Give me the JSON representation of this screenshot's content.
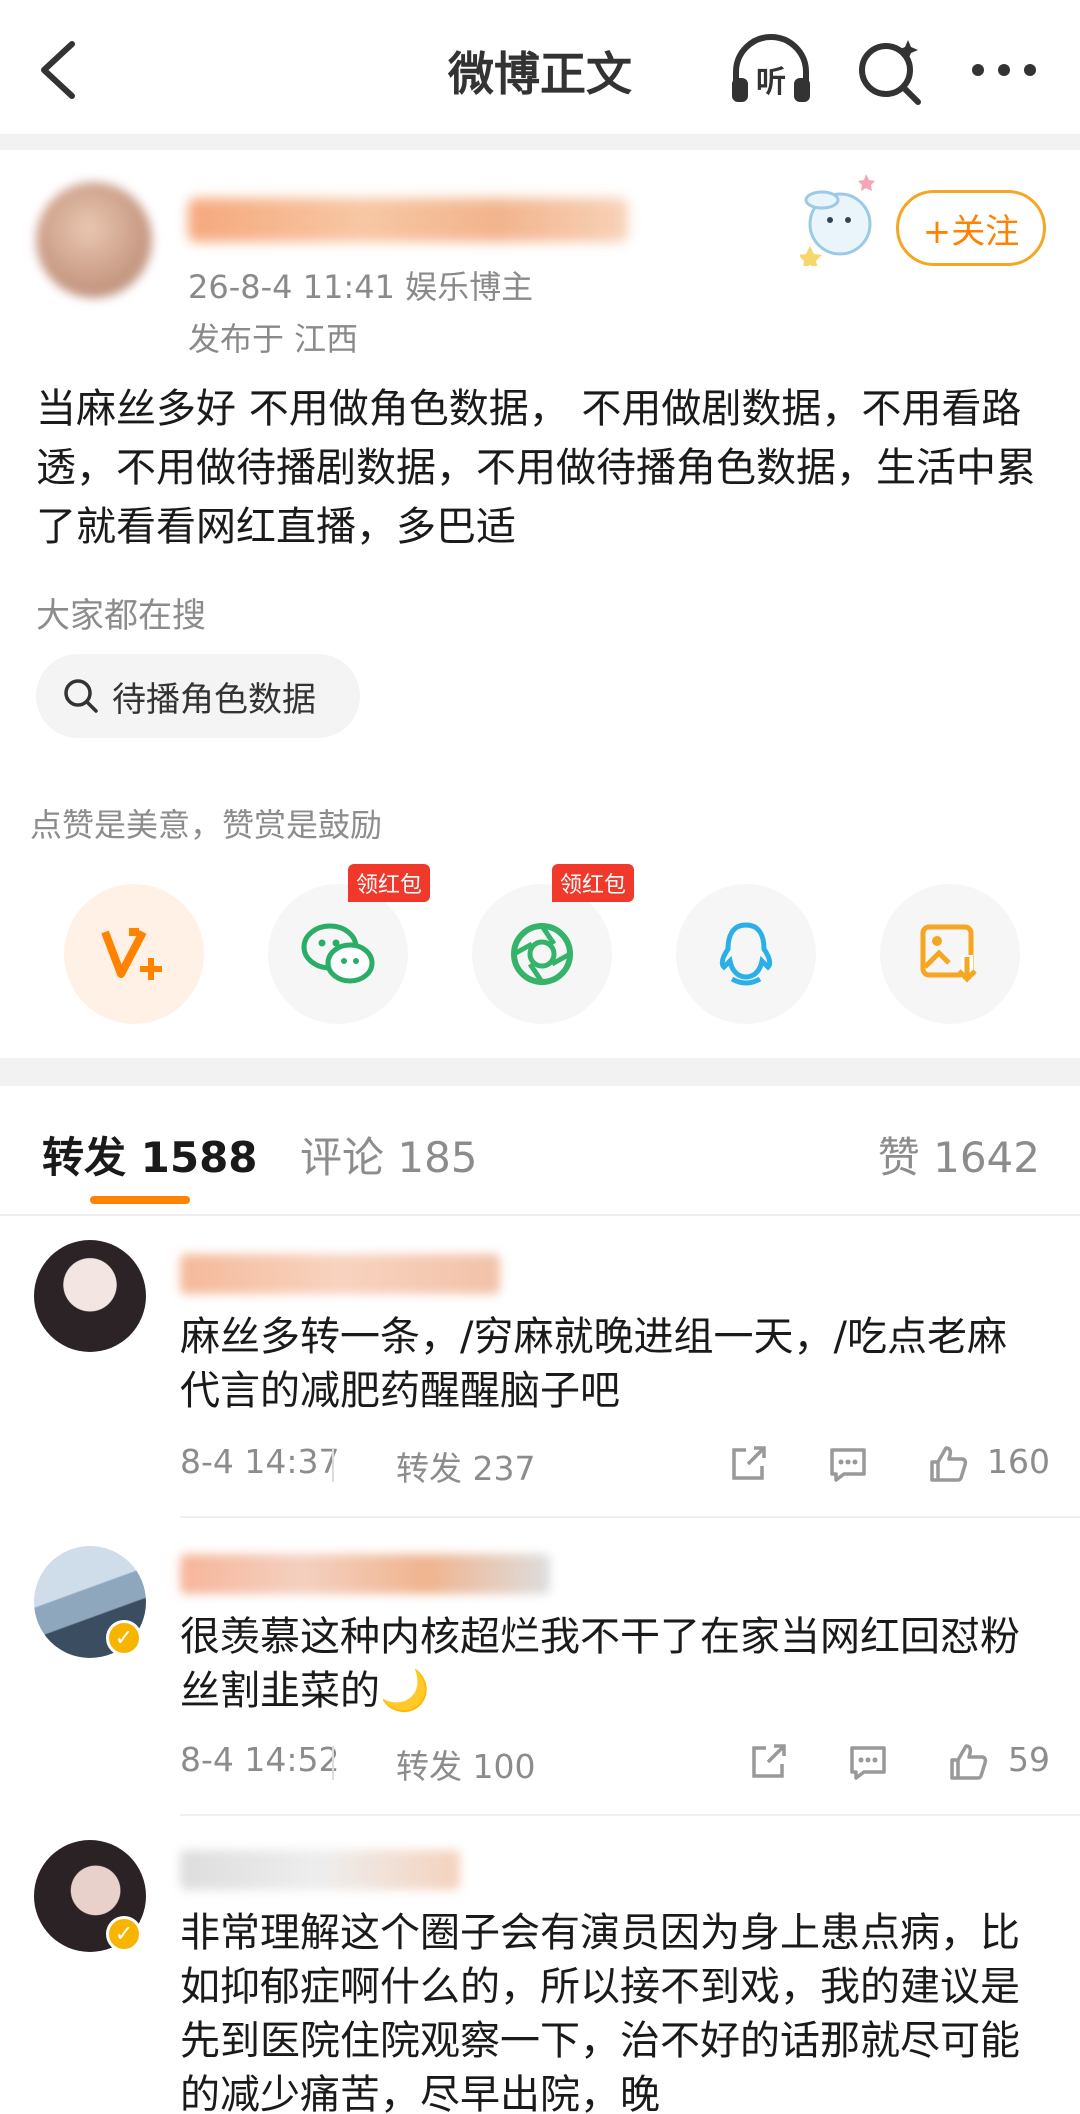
{
  "header": {
    "title": "微博正文",
    "listen_label": "听"
  },
  "author": {
    "meta_line1": "26-8-4 11:41  娱乐博主",
    "meta_line2": "发布于 江西",
    "follow_label": "+关注"
  },
  "post": {
    "text": "当麻丝多好 不用做角色数据， 不用做剧数据，不用看路透，不用做待播剧数据，不用做待播角色数据，生活中累了就看看网红直播，多巴适"
  },
  "search": {
    "label": "大家都在搜",
    "chip": "待播角色数据"
  },
  "like_tip": "点赞是美意，赞赏是鼓励",
  "share": {
    "red_packet_label": "领红包",
    "icons": [
      "vip-plus-icon",
      "wechat-icon",
      "moments-icon",
      "qq-icon",
      "save-image-icon"
    ]
  },
  "tabs": {
    "repost": "转发 1588",
    "comment": "评论 185",
    "like": "赞 1642"
  },
  "reposts": [
    {
      "text": "麻丝多转一条，/穷麻就晚进组一天，/吃点老麻代言的减肥药醒醒脑子吧",
      "time": "8-4 14:37",
      "reposts": "转发 237",
      "likes": "160"
    },
    {
      "text": "很羡慕这种内核超烂我不干了在家当网红回怼粉丝割韭菜的🌙",
      "time": "8-4 14:52",
      "reposts": "转发 100",
      "likes": "59"
    },
    {
      "text": "非常理解这个圈子会有演员因为身上患点病，比如抑郁症啊什么的，所以接不到戏，我的建议是先到医院住院观察一下，治不好的话那就尽可能的减少痛苦，尽早出院，晚"
    }
  ],
  "colors": {
    "accent": "#ff8200",
    "follow_border": "#f5a623",
    "red_packet": "#f0382b",
    "wechat": "#2aae67",
    "moments": "#35b36a",
    "qq": "#2ab0e6",
    "save": "#f5a623"
  }
}
